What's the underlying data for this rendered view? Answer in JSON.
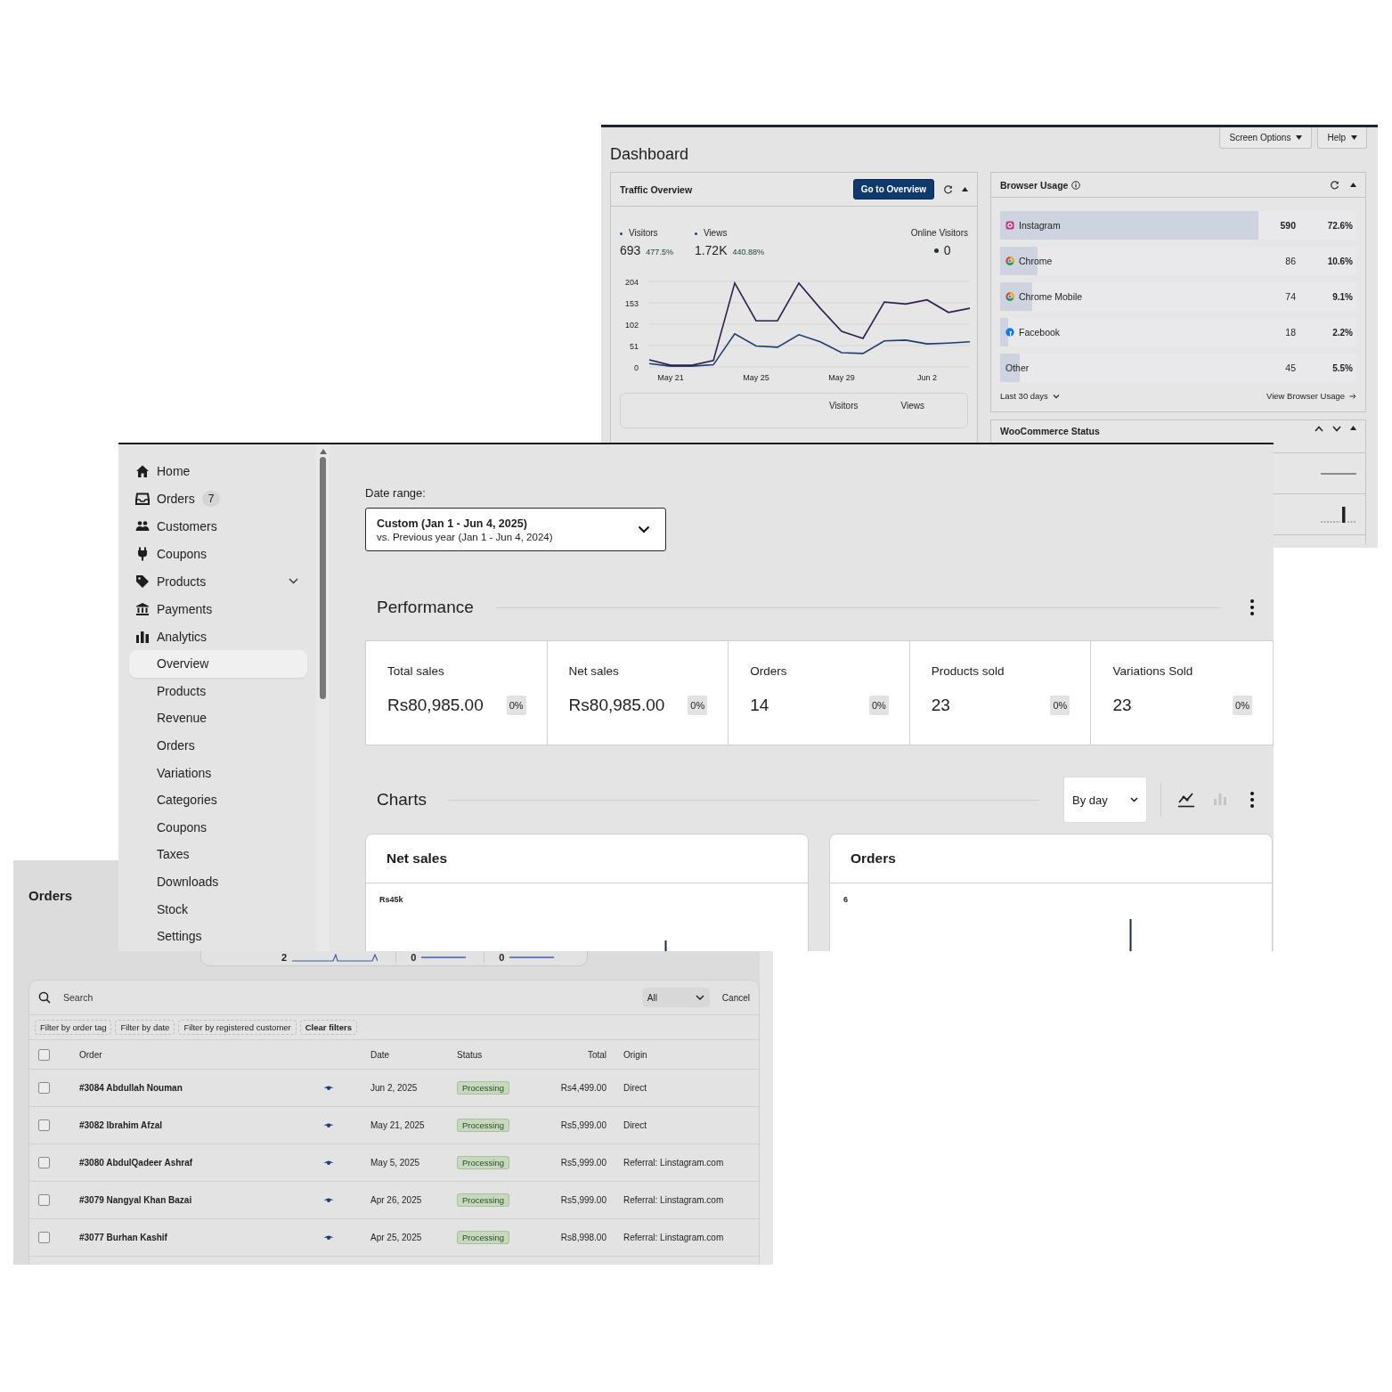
{
  "dashboard_window": {
    "title": "Dashboard",
    "header_buttons": [
      "Screen Options",
      "Help"
    ],
    "traffic_overview": {
      "title": "Traffic Overview",
      "button": "Go to Overview",
      "metrics": [
        {
          "value": "693",
          "change": "477.5%"
        },
        {
          "value": "1.72K",
          "change": "440.88%"
        }
      ],
      "online_visitors": {
        "label": "Online Visitors",
        "value": "0"
      },
      "chart_data": {
        "type": "line",
        "categories": [
          null,
          "May 21",
          null,
          null,
          null,
          "May 25",
          null,
          null,
          null,
          "May 29",
          null,
          null,
          null,
          "Jun 2",
          null,
          null
        ],
        "grid": true,
        "yticks": [
          0,
          51,
          102,
          153,
          204
        ],
        "ylim": [
          0,
          204
        ],
        "series": [
          {
            "name": "Visitors",
            "color": "#1f3b6f",
            "values": [
              8,
              2,
              2,
              5,
              79,
              50,
              47,
              77,
              60,
              34,
              32,
              62,
              64,
              55,
              57,
              60
            ]
          },
          {
            "name": "Views",
            "color": "#2e1f4f",
            "values": [
              17,
              4,
              4,
              15,
              200,
              110,
              110,
              200,
              140,
              85,
              68,
              155,
              150,
              160,
              130,
              140
            ]
          }
        ]
      },
      "table_columns": [
        "Visitors",
        "Views"
      ]
    },
    "browser_usage": {
      "title": "Browser Usage",
      "rows": [
        {
          "name": "Instagram",
          "kind": "camera",
          "count": "590",
          "percent": "72.6%",
          "level": 0.726
        },
        {
          "name": "Chrome",
          "kind": "tricolor",
          "count": "86",
          "percent": "10.6%",
          "level": 0.106
        },
        {
          "name": "Chrome Mobile",
          "kind": "tricolor",
          "count": "74",
          "percent": "9.1%",
          "level": 0.091
        },
        {
          "name": "Facebook",
          "kind": "roundel",
          "count": "18",
          "percent": "2.2%",
          "level": 0.022
        },
        {
          "name": "Other",
          "kind": "plain",
          "count": "45",
          "percent": "5.5%",
          "level": 0.055
        }
      ],
      "period": "Last 30 days",
      "link": "View Browser Usage"
    },
    "woocommerce_status": {
      "title": "WooCommerce Status"
    }
  },
  "analytics_window": {
    "sidebar": {
      "items": [
        {
          "label": "Home"
        },
        {
          "label": "Orders",
          "badge": "7"
        },
        {
          "label": "Customers"
        },
        {
          "label": "Coupons"
        },
        {
          "label": "Products",
          "expanded": false
        },
        {
          "label": "Payments"
        },
        {
          "label": "Analytics",
          "expanded": true,
          "children": [
            {
              "label": "Overview",
              "selected": true
            },
            {
              "label": "Products",
              "selected": false
            },
            {
              "label": "Revenue",
              "selected": false
            },
            {
              "label": "Orders",
              "selected": false
            },
            {
              "label": "Variations",
              "selected": false
            },
            {
              "label": "Categories",
              "selected": false
            },
            {
              "label": "Coupons",
              "selected": false
            },
            {
              "label": "Taxes",
              "selected": false
            },
            {
              "label": "Downloads",
              "selected": false
            },
            {
              "label": "Stock",
              "selected": false
            },
            {
              "label": "Settings",
              "selected": false
            }
          ]
        }
      ]
    },
    "date_range": {
      "label": "Date range:",
      "value": "Custom (Jan 1 - Jun 4, 2025)",
      "comparison": "vs. Previous year (Jan 1 - Jun 4, 2024)"
    },
    "performance": {
      "title": "Performance",
      "kpis": [
        {
          "label": "Total sales",
          "value": "Rs80,985.00",
          "change": "0%"
        },
        {
          "label": "Net sales",
          "value": "Rs80,985.00",
          "change": "0%"
        },
        {
          "label": "Orders",
          "value": "14",
          "change": "0%"
        },
        {
          "label": "Products sold",
          "value": "23",
          "change": "0%"
        },
        {
          "label": "Variations Sold",
          "value": "23",
          "change": "0%"
        }
      ]
    },
    "charts": {
      "title": "Charts",
      "interval": "By day",
      "view_modes": [
        {
          "kind": "line",
          "selected": true
        },
        {
          "kind": "bar",
          "selected": false
        }
      ],
      "cards": [
        {
          "title": "Net sales",
          "axis_label": "Rs45k"
        },
        {
          "title": "Orders",
          "axis_label": "6"
        }
      ]
    }
  },
  "orders_window": {
    "title": "Orders",
    "summary": [
      "2",
      "0",
      "0"
    ],
    "search_placeholder": "Search",
    "status_filter": "All",
    "cancel": "Cancel",
    "filters": [
      {
        "label": "Filter by order tag",
        "kind": "filter"
      },
      {
        "label": "Filter by date",
        "kind": "filter"
      },
      {
        "label": "Filter by registered customer",
        "kind": "filter"
      },
      {
        "label": "Clear filters",
        "kind": "clear"
      }
    ],
    "columns": [
      "Order",
      "Date",
      "Status",
      "Total",
      "Origin"
    ],
    "select_all_checked": false,
    "rows": [
      {
        "order": "#3084 Abdullah Nouman",
        "date": "Jun 2, 2025",
        "status": "Processing",
        "total": "Rs4,499.00",
        "origin": "Direct",
        "checked": false
      },
      {
        "order": "#3082 Ibrahim Afzal",
        "date": "May 21, 2025",
        "status": "Processing",
        "total": "Rs5,999.00",
        "origin": "Direct",
        "checked": false
      },
      {
        "order": "#3080 AbdulQadeer Ashraf",
        "date": "May 5, 2025",
        "status": "Processing",
        "total": "Rs5,999.00",
        "origin": "Referral: Linstagram.com",
        "checked": false
      },
      {
        "order": "#3079 Nangyal Khan Bazai",
        "date": "Apr 26, 2025",
        "status": "Processing",
        "total": "Rs5,999.00",
        "origin": "Referral: Linstagram.com",
        "checked": false
      },
      {
        "order": "#3077 Burhan Kashif",
        "date": "Apr 25, 2025",
        "status": "Processing",
        "total": "Rs8,998.00",
        "origin": "Referral: Linstagram.com",
        "checked": false
      }
    ]
  }
}
